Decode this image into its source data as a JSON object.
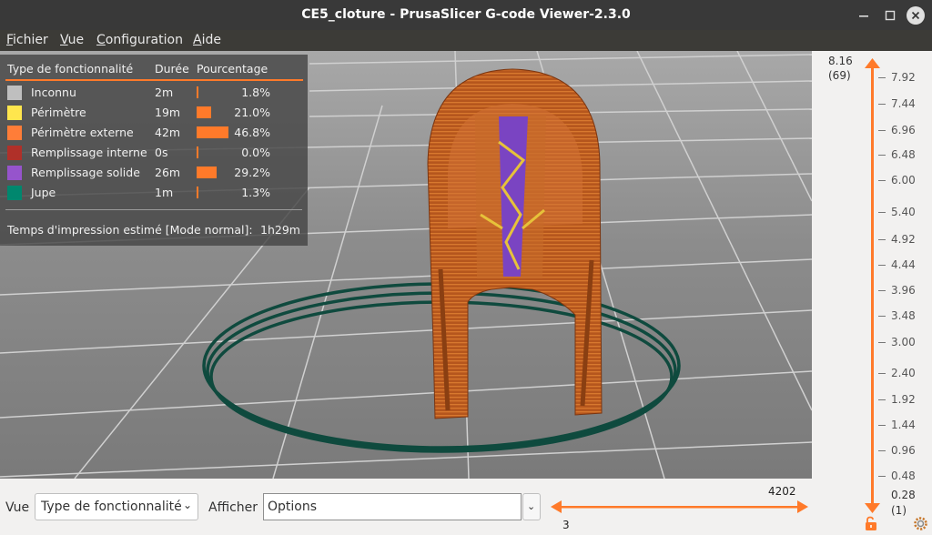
{
  "window": {
    "title": "CE5_cloture - PrusaSlicer G-code Viewer-2.3.0"
  },
  "menu": [
    {
      "label": "Fichier",
      "mnemonic": "F",
      "rest": "ichier"
    },
    {
      "label": "Vue",
      "mnemonic": "V",
      "rest": "ue"
    },
    {
      "label": "Configuration",
      "mnemonic": "C",
      "rest": "onfiguration"
    },
    {
      "label": "Aide",
      "mnemonic": "A",
      "rest": "ide"
    }
  ],
  "legend": {
    "headers": {
      "feature": "Type de fonctionnalité",
      "duration": "Durée",
      "percentage": "Pourcentage"
    },
    "rows": [
      {
        "label": "Inconnu",
        "duration": "2m",
        "percent": "1.8%",
        "fraction": 0.018,
        "color": "#bfbfbf"
      },
      {
        "label": "Périmètre",
        "duration": "19m",
        "percent": "21.0%",
        "fraction": 0.21,
        "color": "#ffe64d"
      },
      {
        "label": "Périmètre externe",
        "duration": "42m",
        "percent": "46.8%",
        "fraction": 0.468,
        "color": "#ff7d38"
      },
      {
        "label": "Remplissage interne",
        "duration": "0s",
        "percent": "0.0%",
        "fraction": 0.0,
        "color": "#b03029"
      },
      {
        "label": "Remplissage solide",
        "duration": "26m",
        "percent": "29.2%",
        "fraction": 0.292,
        "color": "#9654cc"
      },
      {
        "label": "Jupe",
        "duration": "1m",
        "percent": "1.3%",
        "fraction": 0.013,
        "color": "#00876e"
      }
    ],
    "estimate_label": "Temps d'impression estimé [Mode normal]:",
    "estimate_value": "1h29m"
  },
  "layer_slider": {
    "top_value": "8.16",
    "top_index": "(69)",
    "ticks": [
      "7.92",
      "7.44",
      "6.96",
      "6.48",
      "6.00",
      "5.40",
      "4.92",
      "4.44",
      "3.96",
      "3.48",
      "3.00",
      "2.40",
      "1.92",
      "1.44",
      "0.96",
      "0.48"
    ],
    "bottom_value": "0.28",
    "bottom_index": "(1)"
  },
  "bottom": {
    "view_label": "Vue",
    "view_value": "Type de fonctionnalité",
    "show_label": "Afficher",
    "show_value": "Options",
    "hslider_max": "4202",
    "hslider_min": "3"
  },
  "colors": {
    "accent": "#ff7a2a",
    "skirt": "#0f4a3e",
    "object": "#b5561d",
    "solid_infill": "#7a44c2"
  }
}
